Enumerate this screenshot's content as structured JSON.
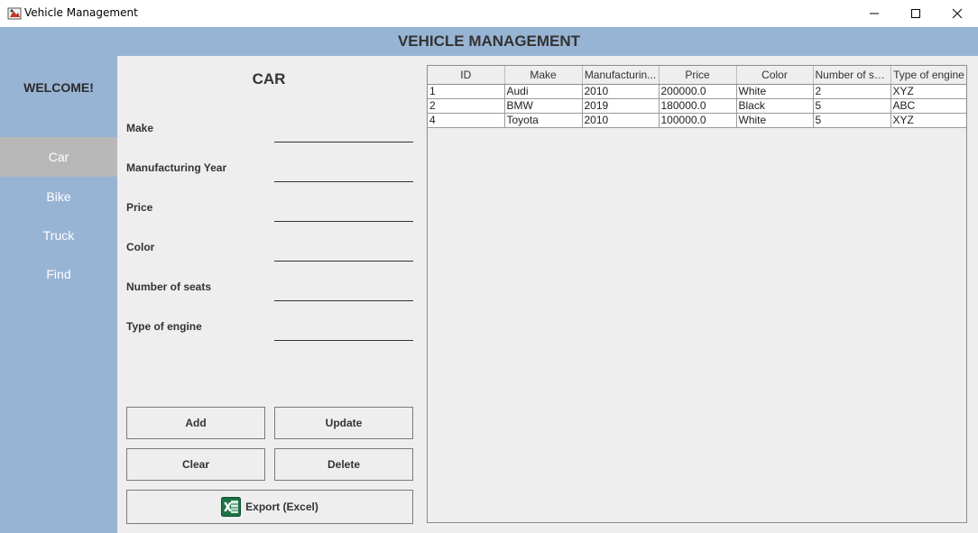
{
  "window": {
    "title": "Vehicle Management"
  },
  "header": {
    "title": "VEHICLE MANAGEMENT"
  },
  "sidebar": {
    "welcome": "WELCOME!",
    "items": [
      {
        "label": "Car",
        "active": true
      },
      {
        "label": "Bike",
        "active": false
      },
      {
        "label": "Truck",
        "active": false
      },
      {
        "label": "Find",
        "active": false
      }
    ]
  },
  "form": {
    "title": "CAR",
    "fields": [
      {
        "label": "Make",
        "value": ""
      },
      {
        "label": "Manufacturing Year",
        "value": ""
      },
      {
        "label": "Price",
        "value": ""
      },
      {
        "label": "Color",
        "value": ""
      },
      {
        "label": "Number of seats",
        "value": ""
      },
      {
        "label": "Type of engine",
        "value": ""
      }
    ],
    "buttons": {
      "add": "Add",
      "update": "Update",
      "clear": "Clear",
      "delete": "Delete",
      "export": "Export (Excel)"
    }
  },
  "table": {
    "columns": [
      "ID",
      "Make",
      "Manufacturin...",
      "Price",
      "Color",
      "Number of se...",
      "Type of engine"
    ],
    "rows": [
      [
        "1",
        "Audi",
        "2010",
        "200000.0",
        "White",
        "2",
        "XYZ"
      ],
      [
        "2",
        "BMW",
        "2019",
        "180000.0",
        "Black",
        "5",
        "ABC"
      ],
      [
        "4",
        "Toyota",
        "2010",
        "100000.0",
        "White",
        "5",
        "XYZ"
      ]
    ]
  },
  "colors": {
    "sidebar_bg": "#98b4d4",
    "panel_bg": "#eeeeee",
    "active_item_bg": "#b8b8b8"
  }
}
